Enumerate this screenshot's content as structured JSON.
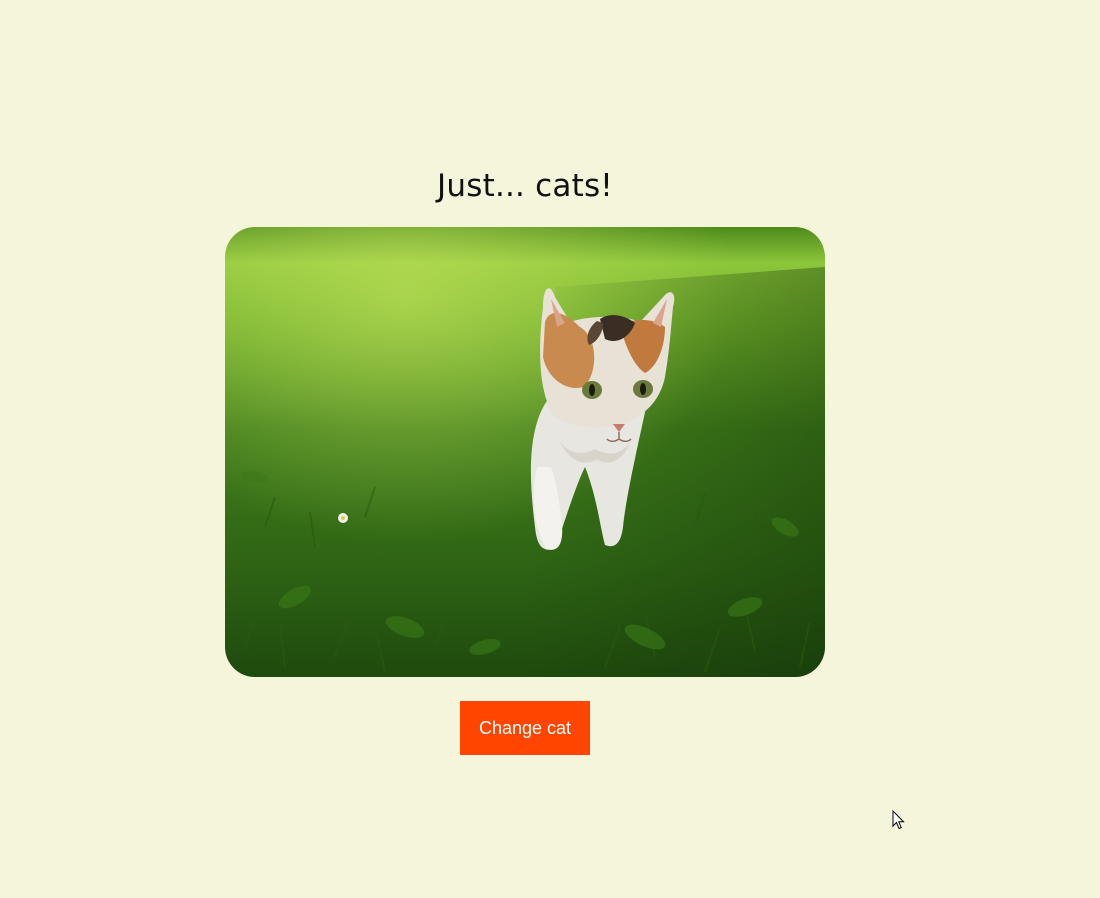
{
  "page": {
    "title": "Just... cats!",
    "background_color": "#f5f5dc"
  },
  "photo": {
    "subject": "calico kitten walking on green grass",
    "alt": "cat"
  },
  "button": {
    "label": "Change cat",
    "color": "#ff4500"
  },
  "cursor": {
    "icon": "mouse-pointer-icon"
  }
}
